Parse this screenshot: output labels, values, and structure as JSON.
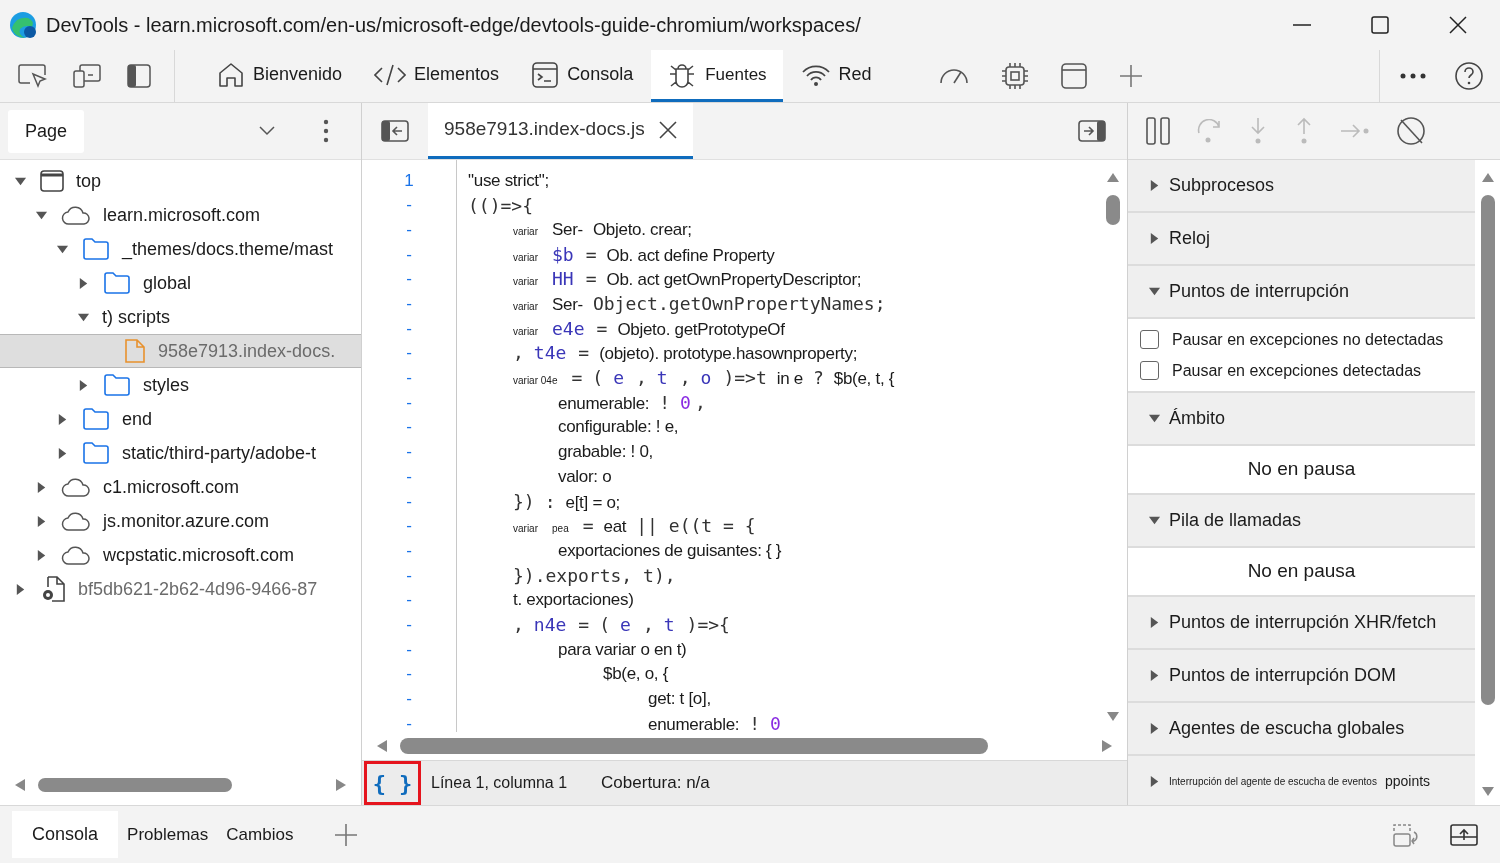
{
  "window": {
    "title": "DevTools - learn.microsoft.com/en-us/microsoft-edge/devtools-guide-chromium/workspaces/"
  },
  "main_tabs": [
    {
      "label": "Bienvenido",
      "kind": "home",
      "selected": false
    },
    {
      "label": "Elementos",
      "kind": "code",
      "selected": false
    },
    {
      "label": "Consola",
      "kind": "console",
      "selected": false
    },
    {
      "label": "Fuentes",
      "kind": "bug",
      "selected": true
    },
    {
      "label": "Red",
      "kind": "wifi",
      "selected": false
    }
  ],
  "navigator": {
    "tabs": [
      {
        "label": "Page",
        "selected": true
      }
    ],
    "tree": [
      {
        "label": "top",
        "kind": "frame",
        "expanded": true,
        "selected": false,
        "children": [
          {
            "label": "learn.microsoft.com",
            "kind": "cloud",
            "expanded": true,
            "selected": false,
            "children": [
              {
                "label": "_themes/docs.theme/mast",
                "kind": "folder",
                "expanded": true,
                "selected": false,
                "children": [
                  {
                    "label": "global",
                    "kind": "folder",
                    "expanded": false,
                    "selected": false
                  },
                  {
                    "label": "t) scripts",
                    "kind": "group",
                    "expanded": true,
                    "selected": false,
                    "children": [
                      {
                        "label": "958e7913.index-docs.",
                        "kind": "file",
                        "selected": true
                      }
                    ]
                  },
                  {
                    "label": "styles",
                    "kind": "folder",
                    "expanded": false,
                    "selected": false
                  }
                ]
              },
              {
                "label": "end",
                "kind": "folder",
                "expanded": false,
                "selected": false
              },
              {
                "label": "static/third-party/adobe-t",
                "kind": "folder",
                "expanded": false,
                "selected": false
              }
            ]
          },
          {
            "label": "c1.microsoft.com",
            "kind": "cloud",
            "expanded": false,
            "selected": false
          },
          {
            "label": "js.monitor.azure.com",
            "kind": "cloud",
            "expanded": false,
            "selected": false
          },
          {
            "label": "wcpstatic.microsoft.com",
            "kind": "cloud",
            "expanded": false,
            "selected": false
          }
        ]
      },
      {
        "label": "bf5db621-2b62-4d96-9466-87",
        "kind": "snippet",
        "expanded": false,
        "selected": false
      }
    ]
  },
  "editor": {
    "tabs": [
      {
        "label": "958e7913.index-docs.js",
        "selected": true
      }
    ],
    "lines": [
      {
        "number": "1",
        "segments": [
          {
            "text": "\"use strict\";",
            "kind": "sans"
          }
        ]
      },
      {
        "number": "-",
        "segments": [
          {
            "text": "(()=>{",
            "kind": "mono"
          }
        ],
        "children": [
          {
            "number": "-",
            "segments": [
              {
                "text": "variar",
                "kind": "tiny"
              },
              {
                "text": "Ser-",
                "kind": "sans"
              },
              {
                "text": "Objeto. crear;",
                "kind": "sans"
              }
            ]
          },
          {
            "number": "-",
            "segments": [
              {
                "text": "variar",
                "kind": "tiny"
              },
              {
                "text": "$b",
                "kind": "ident"
              },
              {
                "text": "=",
                "kind": "mono"
              },
              {
                "text": "Ob. act define Property",
                "kind": "sans"
              }
            ]
          },
          {
            "number": "-",
            "segments": [
              {
                "text": "variar",
                "kind": "tiny"
              },
              {
                "text": "HH",
                "kind": "ident"
              },
              {
                "text": "=",
                "kind": "mono"
              },
              {
                "text": "Ob. act getOwnPropertyDescriptor;",
                "kind": "sans"
              }
            ]
          },
          {
            "number": "-",
            "segments": [
              {
                "text": "variar",
                "kind": "tiny"
              },
              {
                "text": "Ser-",
                "kind": "sans"
              },
              {
                "text": "Object.getOwnPropertyNames;",
                "kind": "mono"
              }
            ]
          },
          {
            "number": "-",
            "segments": [
              {
                "text": "variar",
                "kind": "tiny"
              },
              {
                "text": "e4e",
                "kind": "ident"
              },
              {
                "text": "=",
                "kind": "mono"
              },
              {
                "text": "Objeto. getPrototypeOf",
                "kind": "sans"
              }
            ]
          },
          {
            "number": "-",
            "segments": [
              {
                "text": ",",
                "kind": "mono"
              },
              {
                "text": "t4e",
                "kind": "ident"
              },
              {
                "text": "=",
                "kind": "mono"
              },
              {
                "text": "(objeto). prototype.hasownproperty;",
                "kind": "sans"
              }
            ]
          },
          {
            "number": "-",
            "segments": [
              {
                "text": "variar 04e",
                "kind": "tiny"
              },
              {
                "text": "=",
                "kind": "mono"
              },
              {
                "text": "(",
                "kind": "mono"
              },
              {
                "text": "e",
                "kind": "ident"
              },
              {
                "text": ",",
                "kind": "mono"
              },
              {
                "text": "t",
                "kind": "ident"
              },
              {
                "text": ",",
                "kind": "mono"
              },
              {
                "text": "o",
                "kind": "ident"
              },
              {
                "text": ")=>t",
                "kind": "mono"
              },
              {
                "text": "in e",
                "kind": "sans"
              },
              {
                "text": "?",
                "kind": "mono"
              },
              {
                "text": "$b(e, t, {",
                "kind": "sans"
              }
            ],
            "children": [
              {
                "number": "-",
                "segments": [
                  {
                    "text": "enumerable:",
                    "kind": "sans"
                  },
                  {
                    "text": "!",
                    "kind": "mono"
                  },
                  {
                    "text": "0",
                    "kind": "num"
                  },
                  {
                    "text": ",",
                    "kind": "mono"
                  }
                ]
              },
              {
                "number": "-",
                "segments": [
                  {
                    "text": "configurable: ! e,",
                    "kind": "sans"
                  }
                ]
              },
              {
                "number": "-",
                "segments": [
                  {
                    "text": "grabable: ! 0,",
                    "kind": "sans"
                  }
                ]
              },
              {
                "number": "-",
                "segments": [
                  {
                    "text": "valor: o",
                    "kind": "sans"
                  }
                ]
              }
            ]
          },
          {
            "number": "-",
            "segments": [
              {
                "text": "})",
                "kind": "mono"
              },
              {
                "text": ":",
                "kind": "mono"
              },
              {
                "text": "e[t] = o;",
                "kind": "sans"
              }
            ]
          },
          {
            "number": "-",
            "segments": [
              {
                "text": "variar",
                "kind": "tiny"
              },
              {
                "text": "pea",
                "kind": "tiny"
              },
              {
                "text": "=",
                "kind": "mono"
              },
              {
                "text": "eat",
                "kind": "sans"
              },
              {
                "text": "|| e((t = {",
                "kind": "mono"
              }
            ],
            "children": [
              {
                "number": "-",
                "segments": [
                  {
                    "text": "exportaciones de guisantes: { }",
                    "kind": "sans"
                  }
                ]
              }
            ]
          },
          {
            "number": "-",
            "segments": [
              {
                "text": "}).exports, t),",
                "kind": "mono"
              }
            ]
          },
          {
            "number": "-",
            "segments": [
              {
                "text": "t. exportaciones)",
                "kind": "sans"
              }
            ]
          },
          {
            "number": "-",
            "segments": [
              {
                "text": ",",
                "kind": "mono"
              },
              {
                "text": "n4e",
                "kind": "ident"
              },
              {
                "text": "=",
                "kind": "mono"
              },
              {
                "text": "(",
                "kind": "mono"
              },
              {
                "text": "e",
                "kind": "ident"
              },
              {
                "text": ",",
                "kind": "mono"
              },
              {
                "text": "t",
                "kind": "ident"
              },
              {
                "text": ")=>{",
                "kind": "mono"
              }
            ],
            "children": [
              {
                "number": "-",
                "segments": [
                  {
                    "text": "para variar o en t)",
                    "kind": "sans"
                  }
                ],
                "children": [
                  {
                    "number": "-",
                    "segments": [
                      {
                        "text": "$b(e, o, {",
                        "kind": "sans"
                      }
                    ],
                    "children": [
                      {
                        "number": "-",
                        "segments": [
                          {
                            "text": "get: t [o],",
                            "kind": "sans"
                          }
                        ]
                      },
                      {
                        "number": "-",
                        "segments": [
                          {
                            "text": "enumerable:",
                            "kind": "sans"
                          },
                          {
                            "text": "!",
                            "kind": "mono"
                          },
                          {
                            "text": "0",
                            "kind": "num"
                          }
                        ]
                      }
                    ]
                  }
                ]
              }
            ]
          }
        ]
      }
    ]
  },
  "status_bar": {
    "format_button": "{ }",
    "cursor": "Línea 1, columna 1",
    "coverage": "Cobertura: n/a"
  },
  "debugger": {
    "sections": [
      {
        "title": "Subprocesos",
        "expanded": false
      },
      {
        "title": "Reloj",
        "expanded": false
      },
      {
        "title": "Puntos de interrupción",
        "expanded": true,
        "checkboxes": [
          {
            "label": "Pausar en excepciones no detectadas",
            "checked": false
          },
          {
            "label": "Pausar en excepciones detectadas",
            "checked": false
          }
        ]
      },
      {
        "title": "Ámbito",
        "expanded": true,
        "message": "No en pausa"
      },
      {
        "title": "Pila de llamadas",
        "expanded": true,
        "message": "No en pausa"
      },
      {
        "title": "Puntos de interrupción XHR/fetch",
        "expanded": false
      },
      {
        "title": "Puntos de interrupción DOM",
        "expanded": false
      },
      {
        "title": "Agentes de escucha globales",
        "expanded": false
      },
      {
        "title": "Interrupción del agente de escucha de eventos",
        "suffix": "ppoints",
        "expanded": false
      }
    ]
  },
  "drawer": {
    "tabs": [
      {
        "label": "Consola",
        "selected": true
      },
      {
        "label": "Problemas",
        "selected": false
      },
      {
        "label": "Cambios",
        "selected": false
      }
    ]
  }
}
